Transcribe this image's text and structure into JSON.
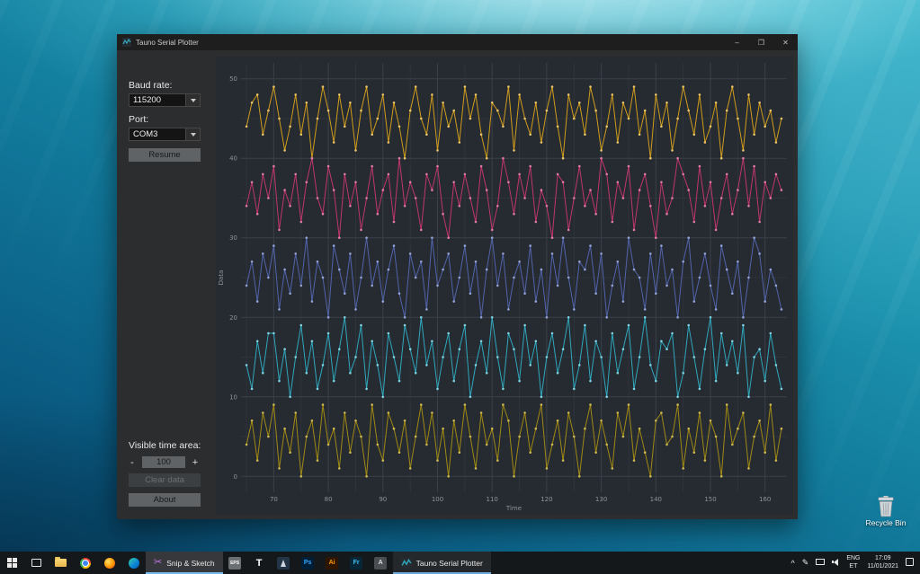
{
  "desktop": {
    "recycle_bin_label": "Recycle Bin"
  },
  "window": {
    "title": "Tauno Serial Plotter",
    "minimize_glyph": "–",
    "maximize_glyph": "❒",
    "close_glyph": "✕"
  },
  "sidebar": {
    "baud_label": "Baud rate:",
    "baud_value": "115200",
    "port_label": "Port:",
    "port_value": "COM3",
    "resume_button": "Resume",
    "visible_time_label": "Visible time area:",
    "decrement": "-",
    "time_area_value": "100",
    "increment": "+",
    "clear_button": "Clear data",
    "about_button": "About"
  },
  "chart_data": {
    "type": "line",
    "title": "",
    "xlabel": "Time",
    "ylabel": "Data",
    "xlim": [
      64,
      164
    ],
    "ylim": [
      -2,
      52
    ],
    "x_ticks": [
      70,
      80,
      90,
      100,
      110,
      120,
      130,
      140,
      150,
      160
    ],
    "y_ticks": [
      0,
      10,
      20,
      30,
      40,
      50
    ],
    "x_minor_step": 5,
    "y_minor_step": 5,
    "grid": true,
    "legend": "none",
    "x_start": 65,
    "x_step": 1,
    "series": [
      {
        "name": "series-1",
        "color": "#d09d1c",
        "dot_color": "#e9c465",
        "values": [
          44,
          47,
          48,
          43,
          46,
          49,
          45,
          41,
          44,
          48,
          43,
          47,
          40,
          45,
          49,
          46,
          42,
          48,
          44,
          47,
          41,
          46,
          49,
          43,
          45,
          48,
          42,
          47,
          44,
          40,
          46,
          49,
          45,
          43,
          48,
          41,
          47,
          44,
          46,
          42,
          49,
          45,
          48,
          43,
          40,
          47,
          46,
          44,
          49,
          41,
          48,
          45,
          43,
          47,
          42,
          46,
          49,
          44,
          40,
          48,
          45,
          47,
          43,
          49,
          46,
          41,
          44,
          48,
          42,
          47,
          45,
          49,
          43,
          46,
          40,
          48,
          44,
          47,
          41,
          45,
          49,
          46,
          43,
          48,
          42,
          44,
          47,
          40,
          46,
          49,
          45,
          41,
          48,
          43,
          47,
          44,
          46,
          42,
          45
        ]
      },
      {
        "name": "series-2",
        "color": "#c0366e",
        "dot_color": "#e07ba4",
        "values": [
          34,
          37,
          33,
          38,
          35,
          39,
          31,
          36,
          34,
          38,
          32,
          37,
          40,
          35,
          33,
          39,
          36,
          30,
          38,
          34,
          37,
          31,
          35,
          39,
          33,
          36,
          38,
          32,
          40,
          34,
          37,
          35,
          31,
          38,
          36,
          39,
          33,
          30,
          37,
          34,
          38,
          35,
          32,
          39,
          36,
          31,
          34,
          40,
          37,
          33,
          38,
          35,
          39,
          32,
          36,
          34,
          30,
          38,
          37,
          31,
          35,
          39,
          34,
          36,
          33,
          40,
          38,
          32,
          37,
          35,
          39,
          31,
          36,
          38,
          34,
          30,
          37,
          33,
          35,
          40,
          38,
          36,
          32,
          39,
          34,
          37,
          31,
          35,
          38,
          33,
          36,
          40,
          34,
          39,
          32,
          37,
          35,
          38,
          36
        ]
      },
      {
        "name": "series-3",
        "color": "#5264ab",
        "dot_color": "#93a2d6",
        "values": [
          24,
          27,
          22,
          28,
          25,
          29,
          21,
          26,
          23,
          28,
          24,
          30,
          22,
          27,
          25,
          20,
          29,
          26,
          23,
          28,
          21,
          25,
          30,
          24,
          27,
          22,
          26,
          29,
          23,
          20,
          28,
          25,
          27,
          21,
          30,
          24,
          26,
          28,
          22,
          25,
          29,
          23,
          27,
          20,
          26,
          30,
          24,
          28,
          21,
          25,
          27,
          23,
          29,
          22,
          26,
          20,
          28,
          24,
          30,
          25,
          21,
          27,
          26,
          29,
          23,
          28,
          20,
          24,
          27,
          22,
          30,
          26,
          25,
          21,
          28,
          23,
          29,
          24,
          26,
          20,
          27,
          30,
          22,
          25,
          28,
          24,
          21,
          29,
          26,
          23,
          27,
          20,
          25,
          30,
          28,
          22,
          26,
          24,
          21
        ]
      },
      {
        "name": "series-4",
        "color": "#2fa8bd",
        "dot_color": "#7fd2e0",
        "values": [
          14,
          11,
          17,
          13,
          18,
          18,
          12,
          16,
          10,
          15,
          19,
          13,
          17,
          11,
          14,
          18,
          12,
          16,
          20,
          13,
          15,
          19,
          11,
          17,
          14,
          10,
          18,
          15,
          12,
          19,
          16,
          13,
          20,
          14,
          17,
          11,
          15,
          18,
          12,
          16,
          19,
          10,
          14,
          17,
          13,
          20,
          15,
          11,
          18,
          16,
          12,
          19,
          14,
          17,
          10,
          15,
          18,
          13,
          16,
          20,
          11,
          14,
          19,
          12,
          17,
          15,
          10,
          18,
          13,
          16,
          19,
          11,
          15,
          20,
          14,
          12,
          17,
          16,
          18,
          10,
          13,
          19,
          15,
          11,
          16,
          20,
          12,
          18,
          14,
          17,
          13,
          19,
          10,
          15,
          16,
          12,
          18,
          14,
          11
        ]
      },
      {
        "name": "series-5",
        "color": "#a18a14",
        "dot_color": "#cdb94f",
        "values": [
          4,
          7,
          2,
          8,
          5,
          9,
          1,
          6,
          3,
          8,
          0,
          5,
          7,
          2,
          9,
          4,
          6,
          1,
          8,
          3,
          7,
          5,
          0,
          9,
          4,
          2,
          8,
          6,
          3,
          7,
          1,
          5,
          9,
          4,
          8,
          2,
          6,
          0,
          7,
          3,
          9,
          5,
          1,
          8,
          4,
          6,
          2,
          9,
          7,
          0,
          5,
          8,
          3,
          6,
          9,
          1,
          4,
          7,
          2,
          8,
          5,
          0,
          6,
          9,
          3,
          7,
          4,
          1,
          8,
          5,
          9,
          2,
          6,
          3,
          0,
          7,
          8,
          4,
          5,
          9,
          1,
          6,
          3,
          8,
          2,
          7,
          5,
          0,
          9,
          4,
          6,
          8,
          1,
          5,
          7,
          3,
          9,
          2,
          6
        ]
      }
    ]
  },
  "taskbar": {
    "snip_sketch_label": "Snip & Sketch",
    "snip_sketch_glyph": "✂",
    "plotter_label": "Tauno Serial Plotter",
    "pinned": [
      {
        "label": "EPS"
      },
      {
        "label": "T"
      },
      {
        "label": ""
      },
      {
        "label": "Ps"
      },
      {
        "label": "Ai"
      },
      {
        "label": "Fr"
      },
      {
        "label": "A"
      }
    ],
    "tray": {
      "hidden_icons_glyph": "^",
      "pen_glyph": "✎",
      "lang_top": "ENG",
      "lang_bottom": "ET",
      "time": "17:09",
      "date": "11/01/2021"
    }
  }
}
